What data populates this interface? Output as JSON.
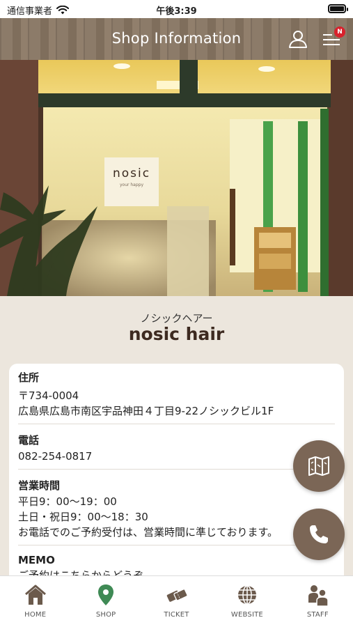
{
  "status_bar": {
    "carrier": "通信事業者",
    "time": "午後3:39"
  },
  "header": {
    "title": "Shop Information",
    "badge": "N"
  },
  "hero": {
    "sign_text": "nosic",
    "sign_sub": "your happy"
  },
  "shop": {
    "kana": "ノシックヘアー",
    "name": "nosic hair"
  },
  "info": {
    "address": {
      "label": "住所",
      "zip": "〒734-0004",
      "street": "広島県広島市南区宇品神田４丁目9-22ノシックビル1F"
    },
    "phone": {
      "label": "電話",
      "number": "082-254-0817"
    },
    "hours": {
      "label": "営業時間",
      "weekday": "平日9：00〜19：00",
      "weekend": "土日・祝日9：00〜18：30",
      "note": "お電話でのご予約受付は、営業時間に準じております。"
    },
    "memo": {
      "label": "MEMO",
      "text": "ご予約はこちらからどうぞ"
    }
  },
  "tabs": [
    {
      "label": "HOME",
      "icon": "home-icon"
    },
    {
      "label": "SHOP",
      "icon": "map-pin-icon"
    },
    {
      "label": "TICKET",
      "icon": "ticket-icon"
    },
    {
      "label": "WEBSITE",
      "icon": "globe-icon"
    },
    {
      "label": "STAFF",
      "icon": "staff-icon"
    }
  ],
  "colors": {
    "accent": "#7b6656",
    "active_tab": "#3f8a55",
    "badge": "#d8212c",
    "tab_icon": "#6b5a4c"
  }
}
